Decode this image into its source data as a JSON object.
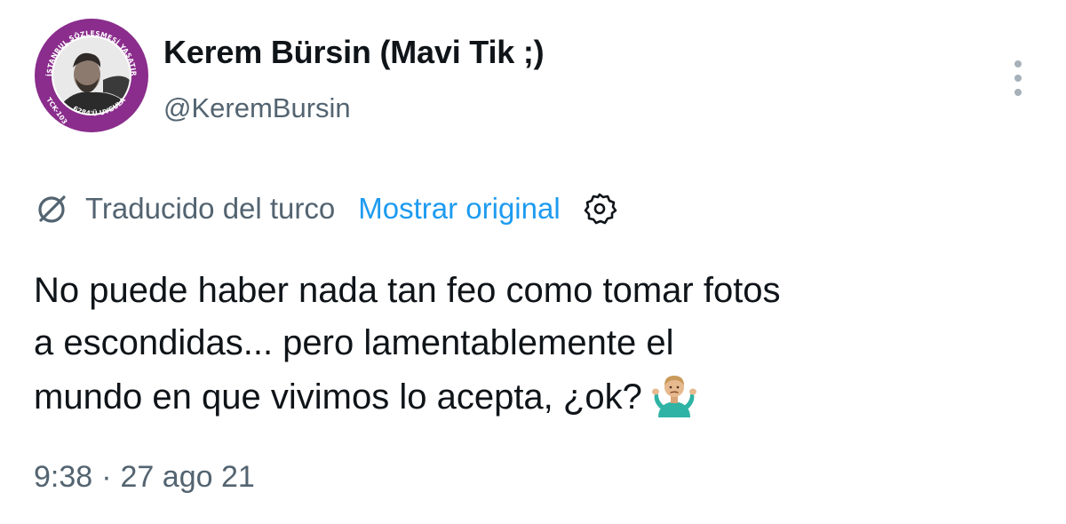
{
  "author": {
    "display_name": "Kerem Bürsin (Mavi Tik ;)",
    "handle": "@KeremBursin",
    "avatar_icon": "avatar-photo",
    "avatar_ring_text_top": "İSTANBUL SÖZLEŞMESİ YAŞATIR",
    "avatar_ring_text_bottom": "6284'Ü UYGULA",
    "avatar_ring_text_left": "TCK-103",
    "avatar_ring_color": "#8a2d8c"
  },
  "menu": {
    "icon": "more-vertical-icon"
  },
  "translation": {
    "icon": "translate-icon",
    "label": "Traducido del turco",
    "show_original_label": "Mostrar original",
    "settings_icon": "settings-gear-icon",
    "link_color": "#1d9bf0"
  },
  "tweet": {
    "lines": [
      "No puede haber nada tan feo como tomar fotos",
      "a escondidas... pero lamentablemente el",
      "mundo en que vivimos lo acepta, ¿ok?"
    ],
    "emoji": "man-shrugging-emoji"
  },
  "meta": {
    "time": "9:38",
    "separator": "·",
    "date": "27 ago 21"
  }
}
